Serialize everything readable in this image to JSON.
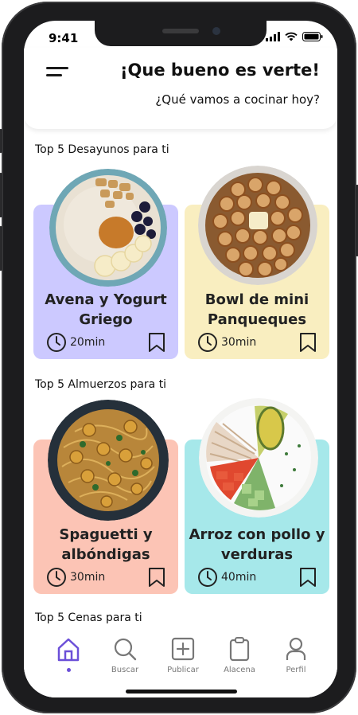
{
  "status_bar": {
    "time": "9:41"
  },
  "header": {
    "title": "¡Que bueno es verte!",
    "subtitle": "¿Qué vamos a cocinar hoy?"
  },
  "sections": [
    {
      "title": "Top 5 Desayunos para ti",
      "cards": [
        {
          "name": "Avena y Yogurt Griego",
          "line1": "Avena y Yogurt",
          "line2": "Griego",
          "time": "20min",
          "color": "#ccc9ff"
        },
        {
          "name": "Bowl de mini Panqueques",
          "line1": "Bowl de mini",
          "line2": "Panqueques",
          "time": "30min",
          "color": "#f9eec0"
        }
      ]
    },
    {
      "title": "Top 5 Almuerzos para ti",
      "cards": [
        {
          "name": "Spaguetti y albóndigas",
          "line1": "Spaguetti y",
          "line2": "albóndigas",
          "time": "30min",
          "color": "#fcc4b5"
        },
        {
          "name": "Arroz con pollo y verduras",
          "line1": "Arroz con pollo y",
          "line2": "verduras",
          "time": "40min",
          "color": "#a6e8ea"
        }
      ]
    },
    {
      "title": "Top 5 Cenas para ti"
    }
  ],
  "nav": {
    "items": [
      {
        "label": "",
        "icon": "home-icon",
        "active": true
      },
      {
        "label": "Buscar",
        "icon": "search-icon"
      },
      {
        "label": "Publicar",
        "icon": "plus-square-icon"
      },
      {
        "label": "Alacena",
        "icon": "clipboard-icon"
      },
      {
        "label": "Perfil",
        "icon": "user-icon"
      }
    ],
    "active_color": "#6b4fd8"
  }
}
